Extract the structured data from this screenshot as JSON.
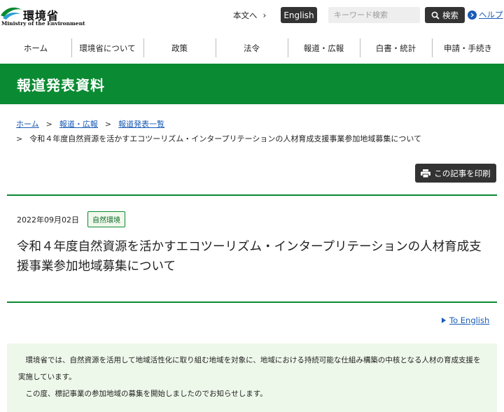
{
  "header": {
    "logo_jp": "環境省",
    "logo_en": "Ministry of the Environment",
    "skip_link": "本文へ",
    "english_button": "English",
    "search_placeholder": "キーワード検索",
    "search_button": "検索",
    "help_link": "ヘルプ"
  },
  "nav": {
    "items": [
      {
        "label": "ホーム"
      },
      {
        "label": "環境省について"
      },
      {
        "label": "政策"
      },
      {
        "label": "法令"
      },
      {
        "label": "報道・広報"
      },
      {
        "label": "白書・統計"
      },
      {
        "label": "申請・手続き"
      }
    ]
  },
  "page_title": "報道発表資料",
  "breadcrumb": {
    "items": [
      "ホーム",
      "報道・広報",
      "報道発表一覧"
    ],
    "separator": ">",
    "current": "令和４年度自然資源を活かすエコツーリズム・インタープリテーションの人材育成支援事業参加地域募集について"
  },
  "print_button": "この記事を印刷",
  "article": {
    "date": "2022年09月02日",
    "tag": "自然環境",
    "title": "令和４年度自然資源を活かすエコツーリズム・インタープリテーションの人材育成支援事業参加地域募集について"
  },
  "to_english": "To English",
  "lead": {
    "p1": "環境省では、自然資源を活用して地域活性化に取り組む地域を対象に、地域における持続可能な仕組み構築の中核となる人材の育成支援を実施しています。",
    "p2": "この度、標記事業の参加地域の募集を開始しましたのでお知らせします。"
  },
  "colors": {
    "brand_green": "#0a8a32",
    "link_blue": "#1a5bb5",
    "dark_button": "#333333"
  }
}
